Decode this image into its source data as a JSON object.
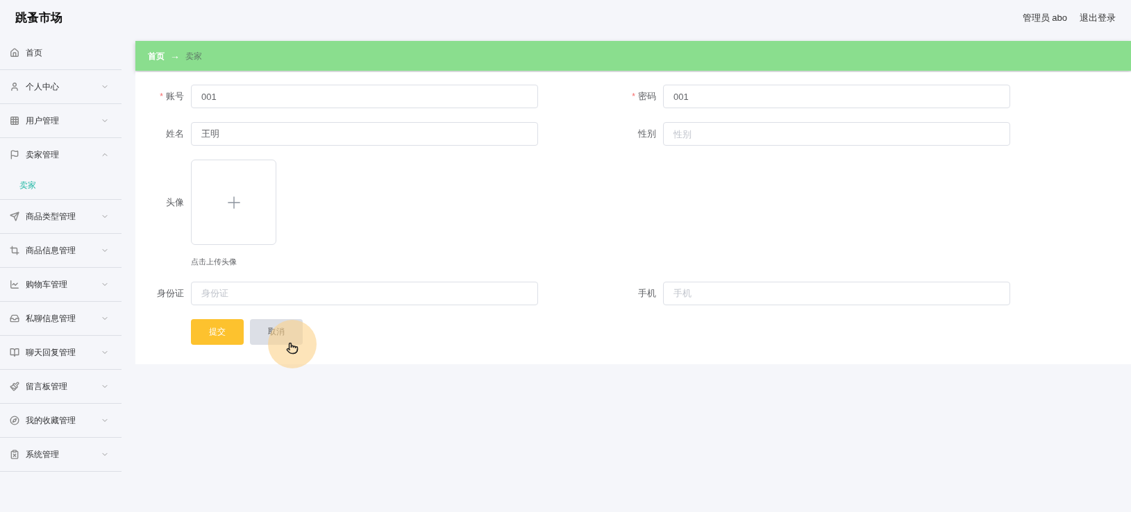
{
  "header": {
    "title": "跳蚤市场",
    "user": "管理员 abo",
    "logout": "退出登录"
  },
  "sidebar": {
    "items": [
      {
        "label": "首页"
      },
      {
        "label": "个人中心",
        "expanded": false
      },
      {
        "label": "用户管理",
        "expanded": false
      },
      {
        "label": "卖家管理",
        "expanded": true,
        "children": [
          {
            "label": "卖家",
            "selected": true
          }
        ]
      },
      {
        "label": "商品类型管理",
        "expanded": false
      },
      {
        "label": "商品信息管理",
        "expanded": false
      },
      {
        "label": "购物车管理",
        "expanded": false
      },
      {
        "label": "私聊信息管理",
        "expanded": false
      },
      {
        "label": "聊天回复管理",
        "expanded": false
      },
      {
        "label": "留言板管理",
        "expanded": false
      },
      {
        "label": "我的收藏管理",
        "expanded": false
      },
      {
        "label": "系统管理",
        "expanded": false
      }
    ]
  },
  "breadcrumb": [
    {
      "label": "首页",
      "selected": false
    },
    {
      "label": "卖家",
      "selected": true
    }
  ],
  "breadcrumb_separator": "→",
  "form": {
    "required_mark": "*",
    "rows": [
      [
        {
          "kind": "text",
          "label": "账号",
          "required": true,
          "value": "001"
        },
        {
          "kind": "text",
          "label": "密码",
          "required": true,
          "value": "001"
        }
      ],
      [
        {
          "kind": "text",
          "label": "姓名",
          "required": false,
          "value": "王明"
        },
        {
          "kind": "text",
          "label": "性别",
          "required": false,
          "placeholder": "性别"
        }
      ],
      [
        {
          "kind": "upload",
          "label": "头像",
          "hint": "点击上传头像"
        }
      ],
      [
        {
          "kind": "text",
          "label": "身份证",
          "required": false,
          "placeholder": "身份证"
        },
        {
          "kind": "text",
          "label": "手机",
          "required": false,
          "placeholder": "手机"
        }
      ]
    ],
    "submit": "提交",
    "cancel": "取消"
  }
}
